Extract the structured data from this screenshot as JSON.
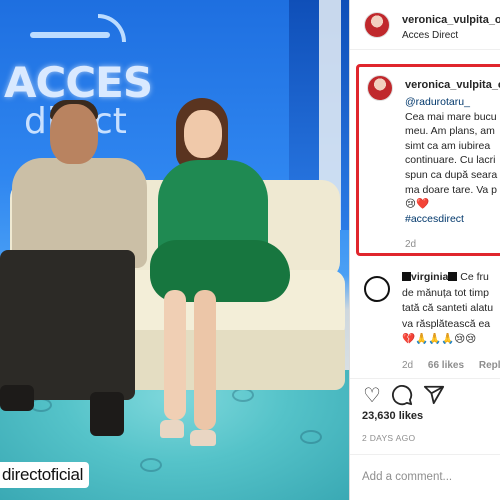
{
  "photo": {
    "logo_line1": "ACCES",
    "logo_line2": "direct",
    "watermark": "directoficial"
  },
  "post_header": {
    "username": "veronica_vulpita_official",
    "location": "Acces Direct"
  },
  "caption": {
    "username": "veronica_vulpita_o",
    "mention": "@radurotaru_",
    "lines": [
      "Cea mai mare bucu",
      "meu. Am plans, am",
      "simt ca am iubirea",
      "continuare. Cu lacri",
      "spun ca după seara",
      "ma doare tare. Va p"
    ],
    "emojis": "😢❤️",
    "hashtag": "#accesdirect",
    "time": "2d"
  },
  "comment": {
    "username": "virginia",
    "lines": [
      "Ce fru",
      "de mănuța tot timp",
      "tată că santeti alatu",
      "va răsplătească ea",
      "💔🙏🙏🙏😢😢"
    ],
    "time": "2d",
    "likes": "66 likes",
    "reply": "Reply"
  },
  "actions": {
    "icons": [
      "heart-icon",
      "comment-icon",
      "share-icon"
    ]
  },
  "likes_count": "23,630 likes",
  "posted_ago": "2 DAYS AGO",
  "add_comment": {
    "placeholder": "Add a comment..."
  },
  "colors": {
    "highlight_border": "#e0262d",
    "link": "#00376b",
    "muted": "#8e8e8e"
  }
}
